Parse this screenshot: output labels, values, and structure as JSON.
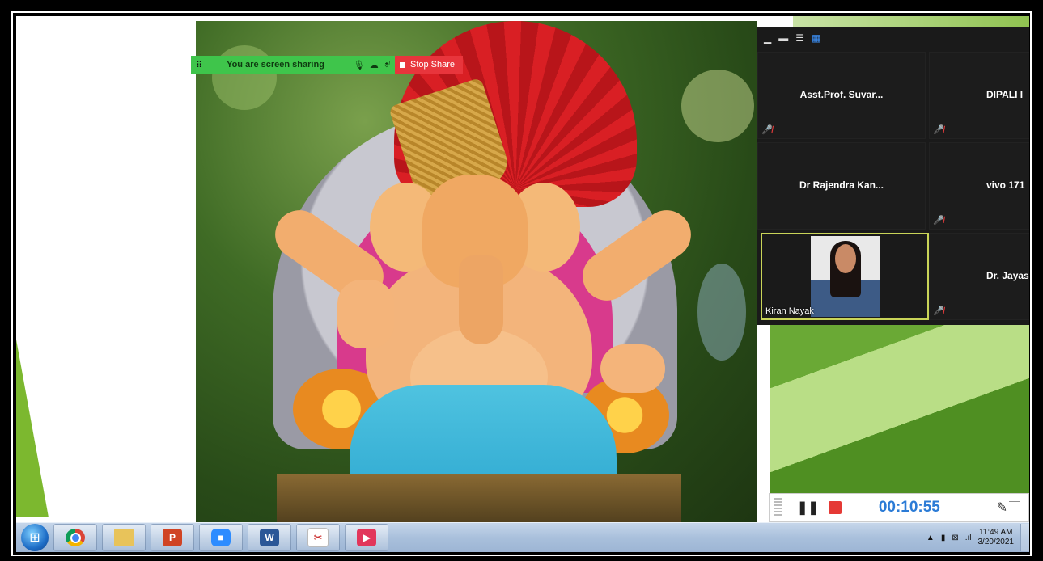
{
  "share_banner": {
    "status_text": "You are screen sharing",
    "stop_label": "Stop Share"
  },
  "gallery": {
    "participants": [
      {
        "name": "Asst.Prof. Suvar..."
      },
      {
        "name": "DIPALI I"
      },
      {
        "name": "Dr Rajendra Kan..."
      },
      {
        "name": "vivo 171"
      },
      {
        "name": "Kiran Nayak"
      },
      {
        "name": "Dr. Jayashre"
      }
    ]
  },
  "recording": {
    "elapsed": "00:10:55"
  },
  "taskbar": {
    "apps": [
      "chrome-icon",
      "folder-icon",
      "powerpoint-icon",
      "zoom-icon",
      "word-icon",
      "snipping-tool-icon",
      "recorder-icon"
    ],
    "ppt_label": "P",
    "word_label": "W",
    "clock_time": "11:49 AM",
    "clock_date": "3/20/2021"
  },
  "colors": {
    "share_green": "#3fc54b",
    "stop_red": "#e8353c",
    "timer_blue": "#2b7bd6",
    "slide_green": "#7cb82f"
  }
}
